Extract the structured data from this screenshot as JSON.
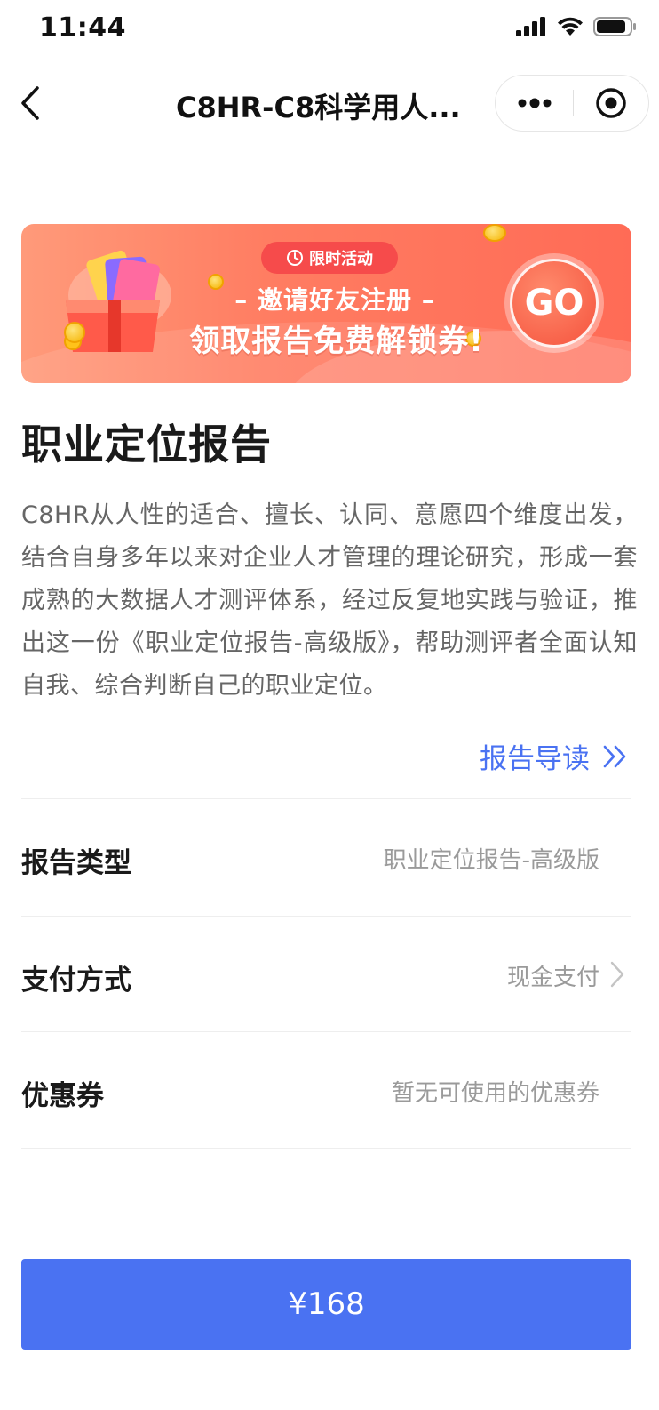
{
  "status_bar": {
    "time": "11:44"
  },
  "nav": {
    "title": "C8HR-C8科学用人..."
  },
  "banner": {
    "badge": "限时活动",
    "line1": "– 邀请好友注册 –",
    "line2": "领取报告免费解锁券!",
    "go": "GO"
  },
  "report": {
    "title": "职业定位报告",
    "description": "C8HR从人性的适合、擅长、认同、意愿四个维度出发，结合自身多年以来对企业人才管理的理论研究，形成一套成熟的大数据人才测评体系，经过反复地实践与验证，推出这一份《职业定位报告-高级版》，帮助测评者全面认知自我、综合判断自己的职业定位。",
    "guide_link": "报告导读"
  },
  "rows": [
    {
      "label": "报告类型",
      "value": "职业定位报告-高级版"
    },
    {
      "label": "支付方式",
      "value": "现金支付"
    },
    {
      "label": "优惠券",
      "value": "暂无可使用的优惠券"
    }
  ],
  "pay_button": {
    "label": "¥168"
  },
  "colors": {
    "accent": "#4a72f2",
    "banner": "#ff7d62"
  }
}
